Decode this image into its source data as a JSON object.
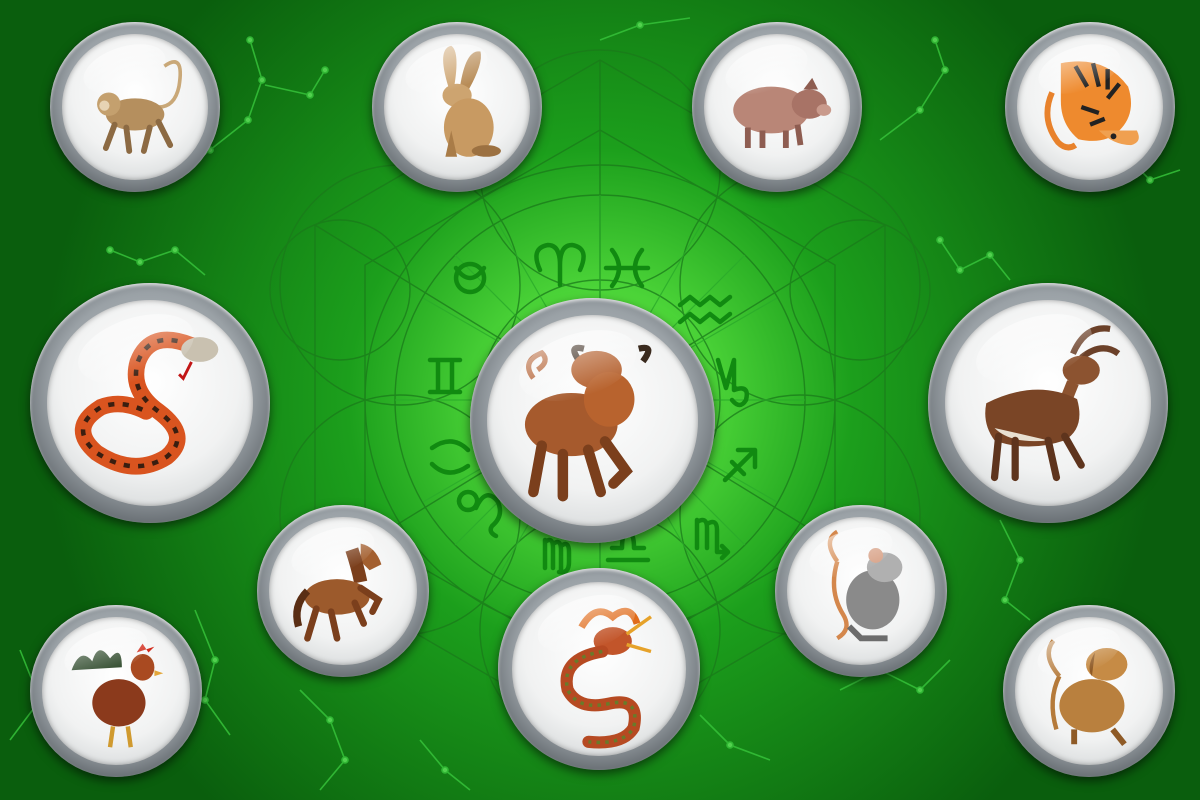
{
  "scene": {
    "background_color": "#0f7a12",
    "glow_color": "#9dff8a",
    "line_color": "#2a9a2a",
    "symbol_color": "#1f8f1f"
  },
  "zodiac_symbols": [
    "aries-icon",
    "pisces-icon",
    "aquarius-icon",
    "capricorn-icon",
    "sagittarius-icon",
    "scorpio-icon",
    "libra-icon",
    "virgo-icon",
    "leo-icon",
    "cancer-icon",
    "gemini-icon",
    "taurus-icon"
  ],
  "medallions": [
    {
      "animal": "monkey",
      "icon": "monkey-icon"
    },
    {
      "animal": "rabbit",
      "icon": "rabbit-icon"
    },
    {
      "animal": "pig",
      "icon": "pig-icon"
    },
    {
      "animal": "tiger",
      "icon": "tiger-icon"
    },
    {
      "animal": "snake",
      "icon": "snake-icon"
    },
    {
      "animal": "ox",
      "icon": "ox-icon"
    },
    {
      "animal": "goat",
      "icon": "goat-icon"
    },
    {
      "animal": "horse",
      "icon": "horse-icon"
    },
    {
      "animal": "rat",
      "icon": "rat-icon"
    },
    {
      "animal": "rooster",
      "icon": "rooster-icon"
    },
    {
      "animal": "dragon",
      "icon": "dragon-icon"
    },
    {
      "animal": "dog",
      "icon": "dog-icon"
    }
  ]
}
